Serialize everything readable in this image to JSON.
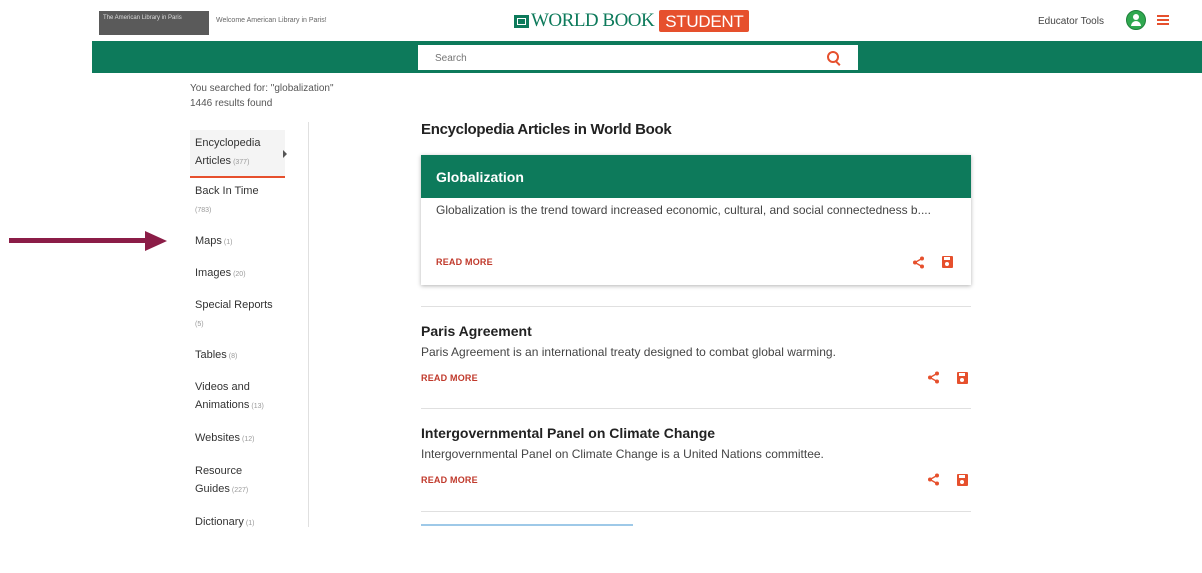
{
  "header": {
    "library_logo_text": "The American Library in Paris",
    "welcome": "Welcome American Library in Paris!",
    "brand_main": "WORLD BOOK",
    "brand_badge": "STUDENT",
    "educator_tools": "Educator Tools"
  },
  "search": {
    "placeholder": "Search"
  },
  "results_info": {
    "searched_for": "You searched for: \"globalization\"",
    "count": "1446 results found"
  },
  "facets": [
    {
      "label": "Encyclopedia Articles",
      "count": "(377)"
    },
    {
      "label": "Back In Time",
      "count": "(783)"
    },
    {
      "label": "Maps",
      "count": "(1)"
    },
    {
      "label": "Images",
      "count": "(20)"
    },
    {
      "label": "Special Reports",
      "count": "(5)"
    },
    {
      "label": "Tables",
      "count": "(8)"
    },
    {
      "label": "Videos and Animations",
      "count": "(13)"
    },
    {
      "label": "Websites",
      "count": "(12)"
    },
    {
      "label": "Resource Guides",
      "count": "(227)"
    },
    {
      "label": "Dictionary",
      "count": "(1)"
    }
  ],
  "main": {
    "section_title": "Encyclopedia Articles in World Book",
    "results": [
      {
        "title": "Globalization",
        "description": "Globalization is the trend toward increased economic, cultural, and social connectedness b....",
        "read_more": "READ MORE"
      },
      {
        "title": "Paris Agreement",
        "description": "Paris Agreement is an international treaty designed to combat global warming.",
        "read_more": "READ MORE"
      },
      {
        "title": "Intergovernmental Panel on Climate Change",
        "description": "Intergovernmental Panel on Climate Change is a United Nations committee.",
        "read_more": "READ MORE"
      }
    ]
  },
  "colors": {
    "brand_green": "#0d7a5b",
    "accent_orange": "#e6502d",
    "annotation_arrow": "#8b1d47"
  },
  "icons": [
    "search-icon",
    "share-icon",
    "save-icon",
    "menu-icon",
    "user-avatar-icon",
    "chevron-right-icon"
  ]
}
